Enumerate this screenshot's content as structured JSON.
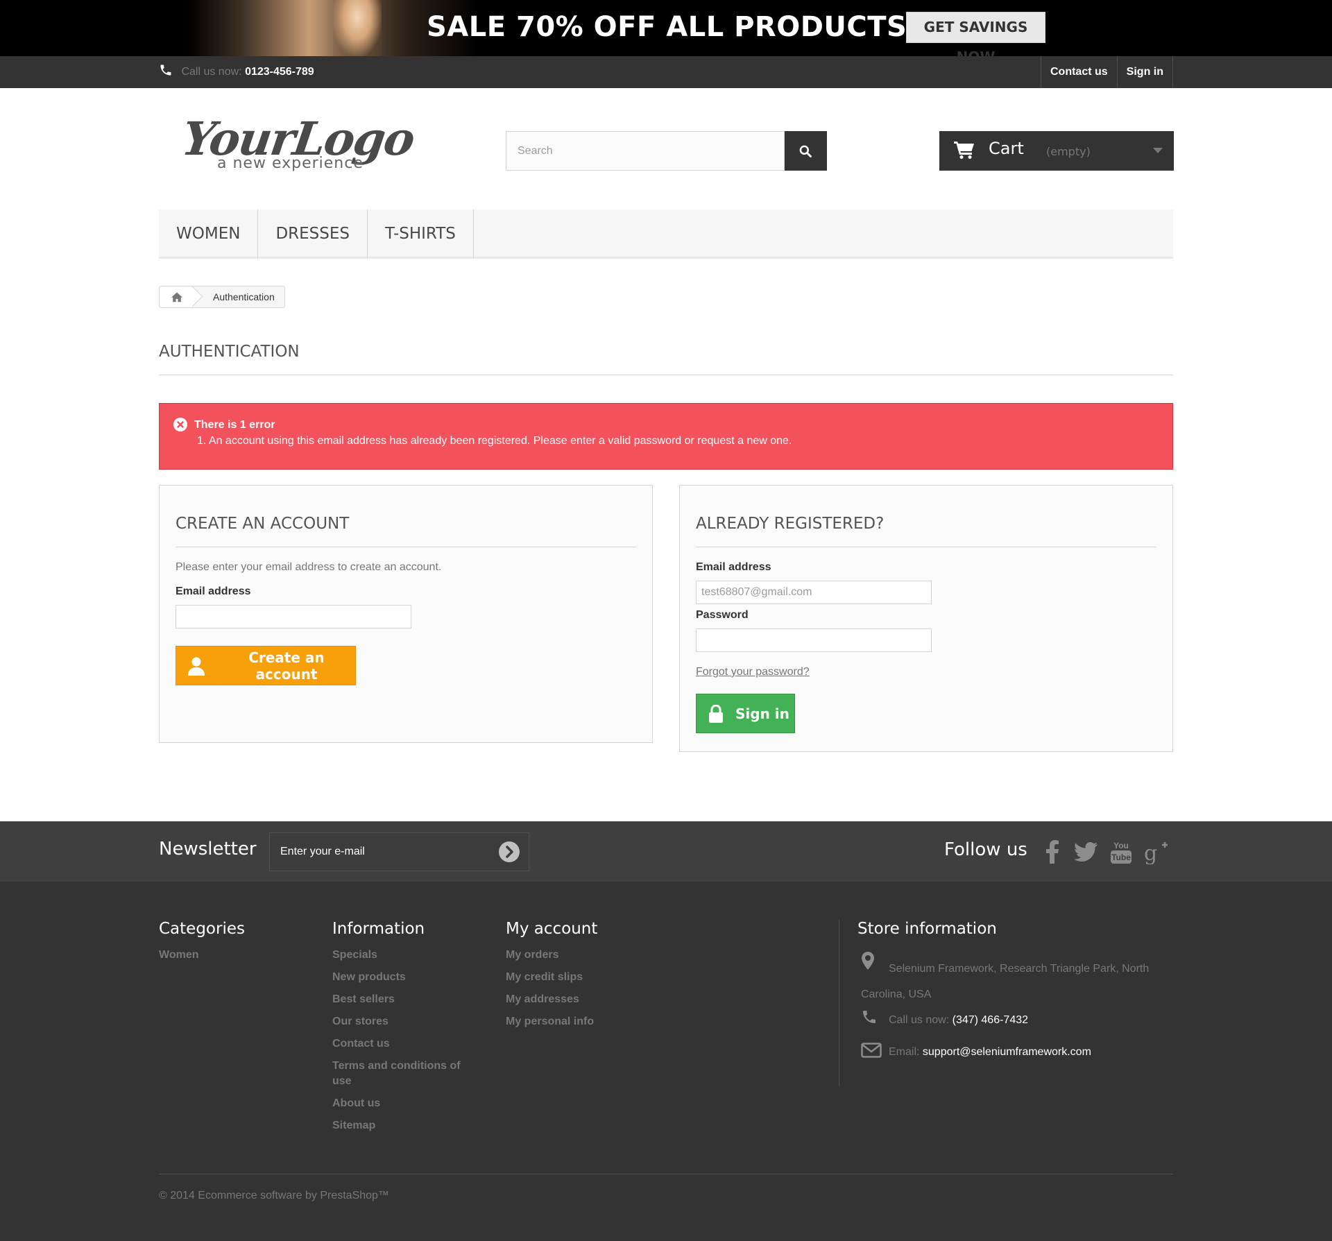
{
  "banner": {
    "headline": "SALE 70% OFF ALL PRODUCTS",
    "cta": "GET SAVINGS NOW"
  },
  "topnav": {
    "call_label": "Call us now:",
    "phone": "0123-456-789",
    "contact": "Contact us",
    "signin": "Sign in"
  },
  "header": {
    "logo_text": "YourLogo",
    "logo_tagline": "a new experience",
    "search_placeholder": "Search",
    "cart_label": "Cart",
    "cart_status": "(empty)"
  },
  "menu": [
    "WOMEN",
    "DRESSES",
    "T-SHIRTS"
  ],
  "breadcrumb": {
    "current": "Authentication"
  },
  "page_title": "AUTHENTICATION",
  "error": {
    "title": "There is 1 error",
    "message": "1. An account using this email address has already been registered. Please enter a valid password or request a new one."
  },
  "create_account": {
    "heading": "CREATE AN ACCOUNT",
    "description": "Please enter your email address to create an account.",
    "email_label": "Email address",
    "email_value": "",
    "button": "Create an account"
  },
  "login": {
    "heading": "ALREADY REGISTERED?",
    "email_label": "Email address",
    "email_value": "test68807@gmail.com",
    "password_label": "Password",
    "password_value": "",
    "forgot": "Forgot your password?",
    "button": "Sign in"
  },
  "newsletter": {
    "title": "Newsletter",
    "placeholder": "Enter your e-mail",
    "follow": "Follow us"
  },
  "footer": {
    "categories": {
      "title": "Categories",
      "items": [
        "Women"
      ]
    },
    "information": {
      "title": "Information",
      "items": [
        "Specials",
        "New products",
        "Best sellers",
        "Our stores",
        "Contact us",
        "Terms and conditions of use",
        "About us",
        "Sitemap"
      ]
    },
    "my_account": {
      "title": "My account",
      "items": [
        "My orders",
        "My credit slips",
        "My addresses",
        "My personal info"
      ]
    },
    "store": {
      "title": "Store information",
      "address": "Selenium Framework, Research Triangle Park, North Carolina, USA",
      "call_label": "Call us now:",
      "phone": "(347) 466-7432",
      "email_label": "Email:",
      "email": "support@seleniumframework.com"
    },
    "copyright": "© 2014 Ecommerce software by PrestaShop™"
  },
  "colors": {
    "error_bg": "#f3515c",
    "create_button": "#f7a00a",
    "signin_button": "#43b155",
    "dark_bar": "#333333"
  }
}
